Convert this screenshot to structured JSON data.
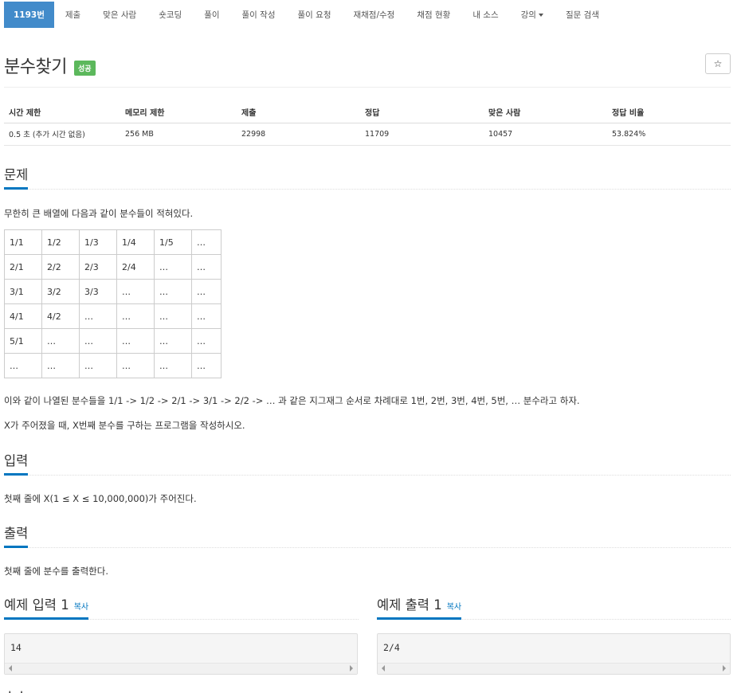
{
  "nav": [
    {
      "label": "1193번",
      "active": true
    },
    {
      "label": "제출"
    },
    {
      "label": "맞은 사람"
    },
    {
      "label": "숏코딩"
    },
    {
      "label": "풀이"
    },
    {
      "label": "풀이 작성"
    },
    {
      "label": "풀이 요청"
    },
    {
      "label": "재채점/수정"
    },
    {
      "label": "채점 현황"
    },
    {
      "label": "내 소스"
    },
    {
      "label": "강의",
      "dropdown": true
    },
    {
      "label": "질문 검색"
    }
  ],
  "problem": {
    "title": "분수찾기",
    "badge": "성공",
    "star": "☆"
  },
  "info": {
    "headers": [
      "시간 제한",
      "메모리 제한",
      "제출",
      "정답",
      "맞은 사람",
      "정답 비율"
    ],
    "values": [
      "0.5 초 (추가 시간 없음)",
      "256 MB",
      "22998",
      "11709",
      "10457",
      "53.824%"
    ]
  },
  "sections": {
    "problem": "문제",
    "input": "입력",
    "output": "출력",
    "sample_input": "예제 입력 1",
    "sample_output": "예제 출력 1",
    "copy": "복사",
    "next": "소스"
  },
  "text": {
    "intro": "무한히 큰 배열에 다음과 같이 분수들이 적혀있다.",
    "desc1": "이와 같이 나열된 분수들을 1/1 -> 1/2 -> 2/1 -> 3/1 -> 2/2 -> … 과 같은 지그재그 순서로 차례대로 1번, 2번, 3번, 4번, 5번, … 분수라고 하자.",
    "desc2": "X가 주어졌을 때, X번째 분수를 구하는 프로그램을 작성하시오.",
    "input_desc": "첫째 줄에 X(1 ≤ X ≤ 10,000,000)가 주어진다.",
    "output_desc": "첫째 줄에 분수를 출력한다."
  },
  "grid": [
    [
      "1/1",
      "1/2",
      "1/3",
      "1/4",
      "1/5",
      "…"
    ],
    [
      "2/1",
      "2/2",
      "2/3",
      "2/4",
      "…",
      "…"
    ],
    [
      "3/1",
      "3/2",
      "3/3",
      "…",
      "…",
      "…"
    ],
    [
      "4/1",
      "4/2",
      "…",
      "…",
      "…",
      "…"
    ],
    [
      "5/1",
      "…",
      "…",
      "…",
      "…",
      "…"
    ],
    [
      "…",
      "…",
      "…",
      "…",
      "…",
      "…"
    ]
  ],
  "samples": {
    "input": "14",
    "output": "2/4"
  },
  "colors": {
    "nav_active": "#428bca",
    "badge": "#5cb85c",
    "accent": "#0076c0"
  }
}
